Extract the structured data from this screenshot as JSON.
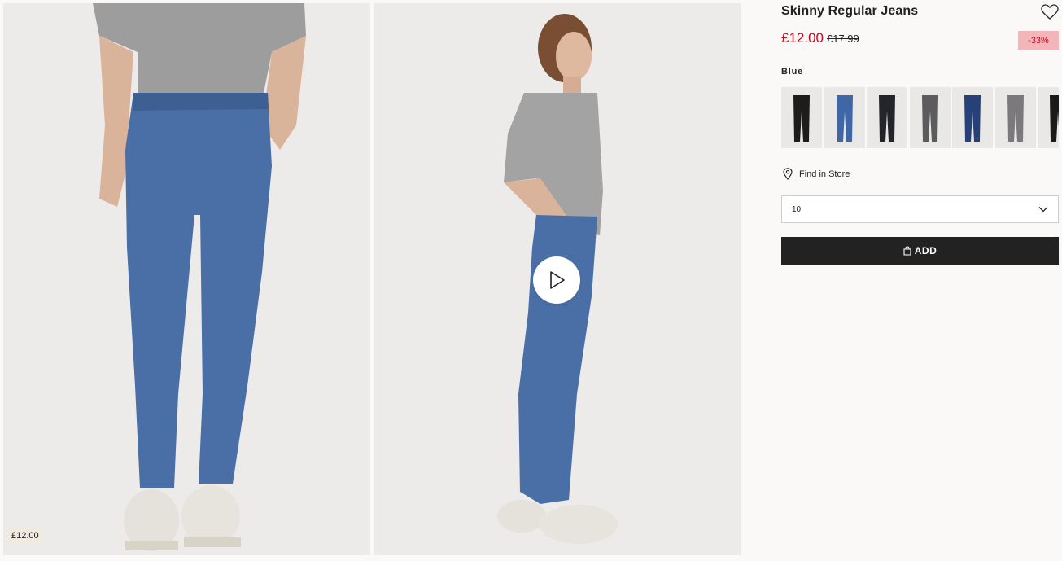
{
  "gallery": {
    "photo_price_tag": "£12.00"
  },
  "product": {
    "title": "Skinny Regular Jeans",
    "price_current": "£12.00",
    "price_original": "£17.99",
    "discount_badge": "-33%",
    "color_label": "Blue",
    "swatches": [
      {
        "name": "black",
        "color": "#1c1c1c"
      },
      {
        "name": "blue",
        "color": "#3f67a6"
      },
      {
        "name": "dark-black",
        "color": "#23252b"
      },
      {
        "name": "dark-grey",
        "color": "#5c5c5e"
      },
      {
        "name": "dark-blue",
        "color": "#26407a"
      },
      {
        "name": "grey",
        "color": "#7a7a7c"
      },
      {
        "name": "black-2",
        "color": "#1a1a1a"
      }
    ],
    "find_in_store": "Find in Store",
    "size_selected": "10",
    "add_label": "ADD"
  },
  "colors": {
    "sale_red": "#d6001c",
    "discount_bg": "#f2b6ba",
    "button_dark": "#222222",
    "denim": "#4a6ea6"
  }
}
